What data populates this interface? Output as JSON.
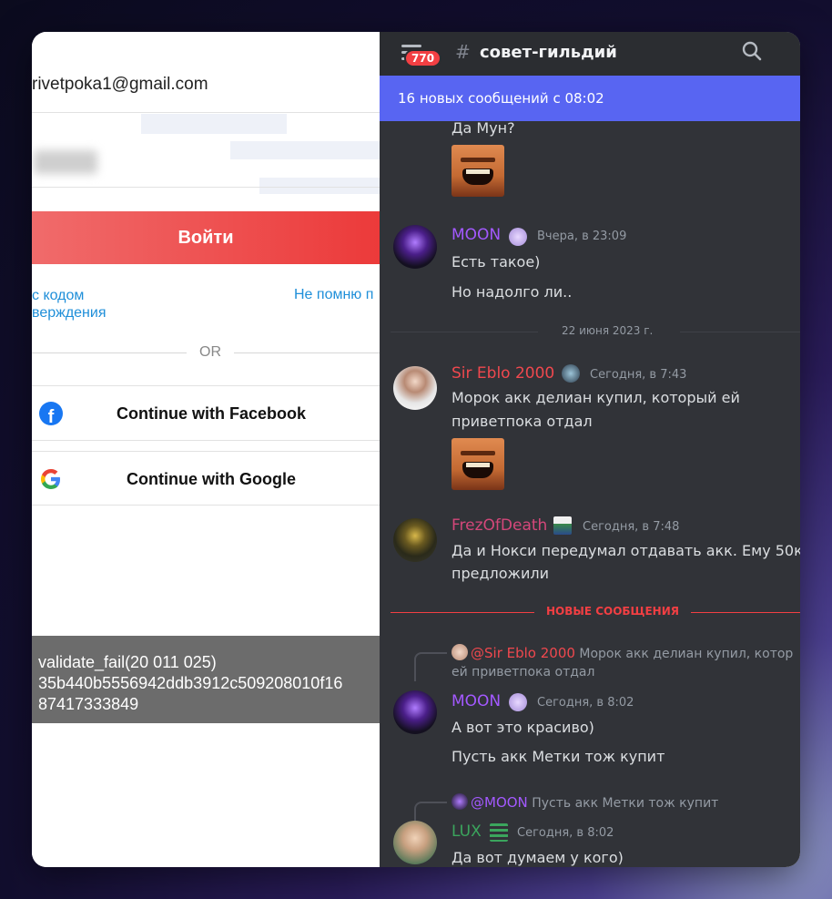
{
  "login": {
    "email": "rivetpoka1@gmail.com",
    "login_button": "Войти",
    "code_link_line1": "с кодом",
    "code_link_line2": "верждения",
    "forgot_link": "Не помню п",
    "or_label": "OR",
    "facebook_button": "Continue with Facebook",
    "google_button": "Continue with Google",
    "toast_line1": "validate_fail(20 011 025)",
    "toast_line2": "35b440b5556942ddb3912c509208010f16",
    "toast_line3": "87417333849"
  },
  "discord": {
    "badge_count": "770",
    "channel_name": "совет-гильдий",
    "new_messages_bar": "16 новых сообщений с 08:02",
    "messages": [
      {
        "text": "Да Мун?"
      },
      {
        "author": "MOON",
        "timestamp": "Вчера, в 23:09",
        "lines": [
          "Есть такое)",
          "Но надолго ли.."
        ]
      },
      {
        "date_divider": "22 июня 2023 г."
      },
      {
        "author": "Sir Eblo 2000",
        "timestamp": "Сегодня, в 7:43",
        "lines": [
          "Морок акк делиан купил, который ей",
          "приветпока отдал"
        ]
      },
      {
        "author": "FrezOfDeath",
        "timestamp": "Сегодня, в 7:48",
        "lines": [
          "Да и Нокси передумал отдавать акк. Ему 50к",
          "предложили"
        ]
      },
      {
        "new_divider": "НОВЫЕ СООБЩЕНИЯ"
      },
      {
        "reply_author": "@Sir Eblo 2000",
        "reply_text_line1": "Морок акк делиан купил, котор",
        "reply_text_line2": "ей приветпока отдал",
        "author": "MOON",
        "timestamp": "Сегодня, в 8:02",
        "lines": [
          "А вот это красиво)",
          "Пусть акк Метки тож купит"
        ]
      },
      {
        "reply_author": "@MOON",
        "reply_text": "Пусть акк Метки тож купит",
        "author": "LUX",
        "timestamp": "Сегодня, в 8:02",
        "lines": [
          "Да вот думаем у кого)"
        ]
      }
    ],
    "colors": {
      "blurple": "#5865f2",
      "background": "#313338",
      "moon": "#a359ff",
      "sir_eblo": "#f0484e",
      "frez": "#d4477a",
      "lux": "#3ba55d"
    }
  }
}
